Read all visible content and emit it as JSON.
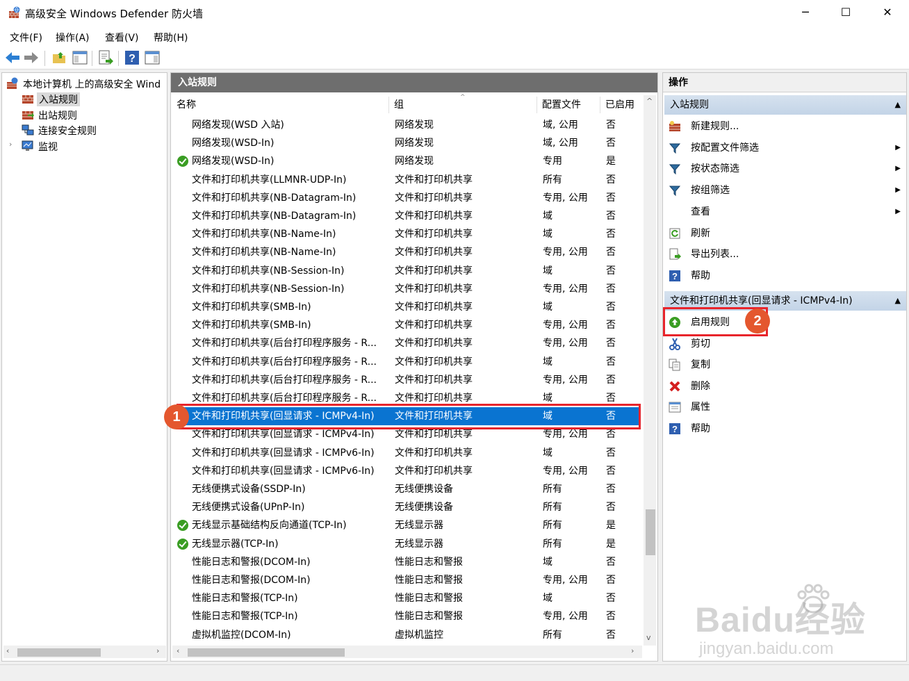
{
  "window": {
    "title": "高级安全 Windows Defender 防火墙",
    "minimize": "─",
    "maximize": "☐",
    "close": "✕"
  },
  "menu": [
    "文件(F)",
    "操作(A)",
    "查看(V)",
    "帮助(H)"
  ],
  "tree": {
    "root": "本地计算机 上的高级安全 Wind",
    "items": [
      "入站规则",
      "出站规则",
      "连接安全规则",
      "监视"
    ],
    "selected": "入站规则"
  },
  "center": {
    "header": "入站规则",
    "columns": [
      "名称",
      "组",
      "配置文件",
      "已启用"
    ],
    "rows": [
      {
        "name": "网络发现(WSD 入站)",
        "group": "网络发现",
        "profile": "域, 公用",
        "enabled": "否",
        "ok": false
      },
      {
        "name": "网络发现(WSD-In)",
        "group": "网络发现",
        "profile": "域, 公用",
        "enabled": "否",
        "ok": false
      },
      {
        "name": "网络发现(WSD-In)",
        "group": "网络发现",
        "profile": "专用",
        "enabled": "是",
        "ok": true
      },
      {
        "name": "文件和打印机共享(LLMNR-UDP-In)",
        "group": "文件和打印机共享",
        "profile": "所有",
        "enabled": "否",
        "ok": false
      },
      {
        "name": "文件和打印机共享(NB-Datagram-In)",
        "group": "文件和打印机共享",
        "profile": "专用, 公用",
        "enabled": "否",
        "ok": false
      },
      {
        "name": "文件和打印机共享(NB-Datagram-In)",
        "group": "文件和打印机共享",
        "profile": "域",
        "enabled": "否",
        "ok": false
      },
      {
        "name": "文件和打印机共享(NB-Name-In)",
        "group": "文件和打印机共享",
        "profile": "域",
        "enabled": "否",
        "ok": false
      },
      {
        "name": "文件和打印机共享(NB-Name-In)",
        "group": "文件和打印机共享",
        "profile": "专用, 公用",
        "enabled": "否",
        "ok": false
      },
      {
        "name": "文件和打印机共享(NB-Session-In)",
        "group": "文件和打印机共享",
        "profile": "域",
        "enabled": "否",
        "ok": false
      },
      {
        "name": "文件和打印机共享(NB-Session-In)",
        "group": "文件和打印机共享",
        "profile": "专用, 公用",
        "enabled": "否",
        "ok": false
      },
      {
        "name": "文件和打印机共享(SMB-In)",
        "group": "文件和打印机共享",
        "profile": "域",
        "enabled": "否",
        "ok": false
      },
      {
        "name": "文件和打印机共享(SMB-In)",
        "group": "文件和打印机共享",
        "profile": "专用, 公用",
        "enabled": "否",
        "ok": false
      },
      {
        "name": "文件和打印机共享(后台打印程序服务 - R...",
        "group": "文件和打印机共享",
        "profile": "专用, 公用",
        "enabled": "否",
        "ok": false
      },
      {
        "name": "文件和打印机共享(后台打印程序服务 - R...",
        "group": "文件和打印机共享",
        "profile": "域",
        "enabled": "否",
        "ok": false
      },
      {
        "name": "文件和打印机共享(后台打印程序服务 - R...",
        "group": "文件和打印机共享",
        "profile": "专用, 公用",
        "enabled": "否",
        "ok": false
      },
      {
        "name": "文件和打印机共享(后台打印程序服务 - R...",
        "group": "文件和打印机共享",
        "profile": "域",
        "enabled": "否",
        "ok": false
      },
      {
        "name": "文件和打印机共享(回显请求 - ICMPv4-In)",
        "group": "文件和打印机共享",
        "profile": "域",
        "enabled": "否",
        "ok": false,
        "selected": true
      },
      {
        "name": "文件和打印机共享(回显请求 - ICMPv4-In)",
        "group": "文件和打印机共享",
        "profile": "专用, 公用",
        "enabled": "否",
        "ok": false
      },
      {
        "name": "文件和打印机共享(回显请求 - ICMPv6-In)",
        "group": "文件和打印机共享",
        "profile": "域",
        "enabled": "否",
        "ok": false
      },
      {
        "name": "文件和打印机共享(回显请求 - ICMPv6-In)",
        "group": "文件和打印机共享",
        "profile": "专用, 公用",
        "enabled": "否",
        "ok": false
      },
      {
        "name": "无线便携式设备(SSDP-In)",
        "group": "无线便携设备",
        "profile": "所有",
        "enabled": "否",
        "ok": false
      },
      {
        "name": "无线便携式设备(UPnP-In)",
        "group": "无线便携设备",
        "profile": "所有",
        "enabled": "否",
        "ok": false
      },
      {
        "name": "无线显示基础结构反向通道(TCP-In)",
        "group": "无线显示器",
        "profile": "所有",
        "enabled": "是",
        "ok": true
      },
      {
        "name": "无线显示器(TCP-In)",
        "group": "无线显示器",
        "profile": "所有",
        "enabled": "是",
        "ok": true
      },
      {
        "name": "性能日志和警报(DCOM-In)",
        "group": "性能日志和警报",
        "profile": "域",
        "enabled": "否",
        "ok": false
      },
      {
        "name": "性能日志和警报(DCOM-In)",
        "group": "性能日志和警报",
        "profile": "专用, 公用",
        "enabled": "否",
        "ok": false
      },
      {
        "name": "性能日志和警报(TCP-In)",
        "group": "性能日志和警报",
        "profile": "域",
        "enabled": "否",
        "ok": false
      },
      {
        "name": "性能日志和警报(TCP-In)",
        "group": "性能日志和警报",
        "profile": "专用, 公用",
        "enabled": "否",
        "ok": false
      },
      {
        "name": "虚拟机监控(DCOM-In)",
        "group": "虚拟机监控",
        "profile": "所有",
        "enabled": "否",
        "ok": false
      }
    ]
  },
  "actions": {
    "title": "操作",
    "section1": {
      "title": "入站规则",
      "items": [
        {
          "label": "新建规则...",
          "icon": "new-rule-icon",
          "submenu": false
        },
        {
          "label": "按配置文件筛选",
          "icon": "filter-icon",
          "submenu": true
        },
        {
          "label": "按状态筛选",
          "icon": "filter-icon",
          "submenu": true
        },
        {
          "label": "按组筛选",
          "icon": "filter-icon",
          "submenu": true
        },
        {
          "label": "查看",
          "icon": "",
          "submenu": true
        },
        {
          "label": "刷新",
          "icon": "refresh-icon",
          "submenu": false
        },
        {
          "label": "导出列表...",
          "icon": "export-icon",
          "submenu": false
        },
        {
          "label": "帮助",
          "icon": "help-icon",
          "submenu": false
        }
      ]
    },
    "section2": {
      "title": "文件和打印机共享(回显请求 - ICMPv4-In)",
      "items": [
        {
          "label": "启用规则",
          "icon": "enable-rule-icon"
        },
        {
          "label": "剪切",
          "icon": "cut-icon"
        },
        {
          "label": "复制",
          "icon": "copy-icon"
        },
        {
          "label": "删除",
          "icon": "delete-icon"
        },
        {
          "label": "属性",
          "icon": "properties-icon"
        },
        {
          "label": "帮助",
          "icon": "help-icon"
        }
      ]
    }
  },
  "annotations": {
    "badge1": "1",
    "badge2": "2",
    "color": "#e8242b"
  },
  "watermark": {
    "main": "Baidu经验",
    "sub": "jingyan.baidu.com"
  },
  "colors": {
    "selection": "#0a74d1",
    "section_header": "#c8d8ea",
    "pane_header": "#6e6e6e",
    "check_green": "#3a9d23"
  }
}
